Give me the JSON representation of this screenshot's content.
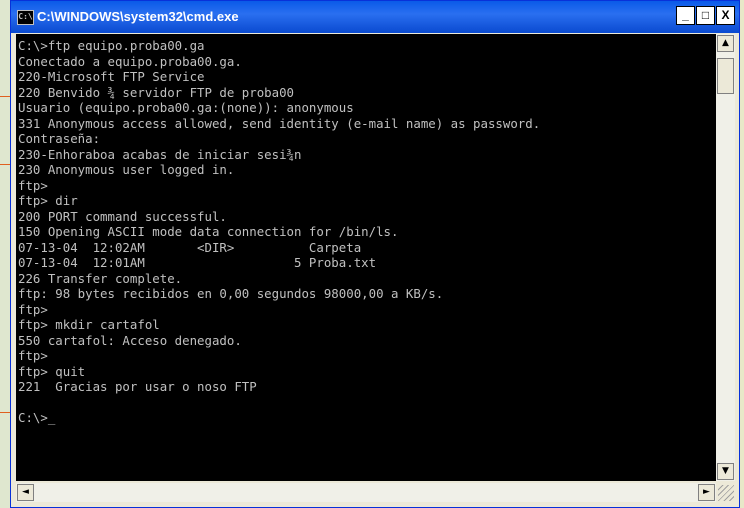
{
  "window": {
    "title": "C:\\WINDOWS\\system32\\cmd.exe",
    "icon": "cmd-icon",
    "icon_glyph": "C:\\",
    "buttons": {
      "minimize": "_",
      "maximize": "□",
      "close": "X"
    }
  },
  "console": {
    "text": "C:\\>ftp equipo.proba00.ga\nConectado a equipo.proba00.ga.\n220-Microsoft FTP Service\n220 Benvido ¾ servidor FTP de proba00\nUsuario (equipo.proba00.ga:(none)): anonymous\n331 Anonymous access allowed, send identity (e-mail name) as password.\nContraseña:\n230-Enhoraboa acabas de iniciar sesi¾n\n230 Anonymous user logged in.\nftp>\nftp> dir\n200 PORT command successful.\n150 Opening ASCII mode data connection for /bin/ls.\n07-13-04  12:02AM       <DIR>          Carpeta\n07-13-04  12:01AM                    5 Proba.txt\n226 Transfer complete.\nftp: 98 bytes recibidos en 0,00 segundos 98000,00 a KB/s.\nftp>\nftp> mkdir cartafol\n550 cartafol: Acceso denegado.\nftp>\nftp> quit\n221  Gracias por usar o noso FTP\n\nC:\\>_"
  },
  "scrollbars": {
    "up": "▲",
    "down": "▼",
    "left": "◄",
    "right": "►"
  }
}
